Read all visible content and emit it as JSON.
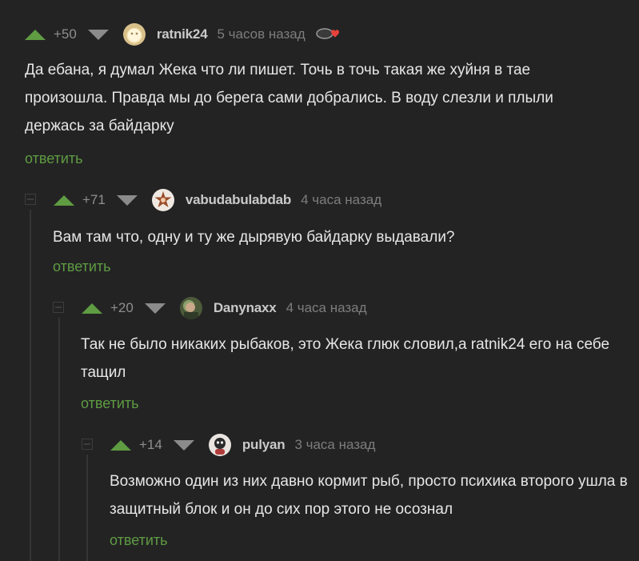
{
  "comments": [
    {
      "rating": "+50",
      "author": "ratnik24",
      "time": "5 часов назад",
      "text": "Да ебана, я думал Жека что ли пишет. Точь в точь такая же хуйня в тае произошла. Правда мы до берега сами добрались. В воду слезли и плыли держась за байдарку",
      "reply": "ответить"
    },
    {
      "rating": "+71",
      "author": "vabudabulabdab",
      "time": "4 часа назад",
      "text": "Вам там что, одну и ту же дырявую байдарку выдавали?",
      "reply": "ответить"
    },
    {
      "rating": "+20",
      "author": "Danynaxx",
      "time": "4 часа назад",
      "text": "Так не было никаких рыбаков, это Жека глюк словил,а ratnik24 его на себе тащил",
      "reply": "ответить"
    },
    {
      "rating": "+14",
      "author": "pulyan",
      "time": "3 часа назад",
      "text": "Возможно один из них давно кормит рыб, просто психика второго ушла в защитный блок и он до сих пор этого не осознал",
      "reply": "ответить"
    }
  ],
  "colors": {
    "background": "#232324",
    "upvote": "#5f9c42",
    "reply_link": "#5f9c42",
    "downvote": "#8b8b8b",
    "heart_badge": "#e8413b"
  },
  "icons": [
    "upvote-arrow-icon",
    "downvote-arrow-icon",
    "heart-badge-icon",
    "collapse-icon"
  ]
}
